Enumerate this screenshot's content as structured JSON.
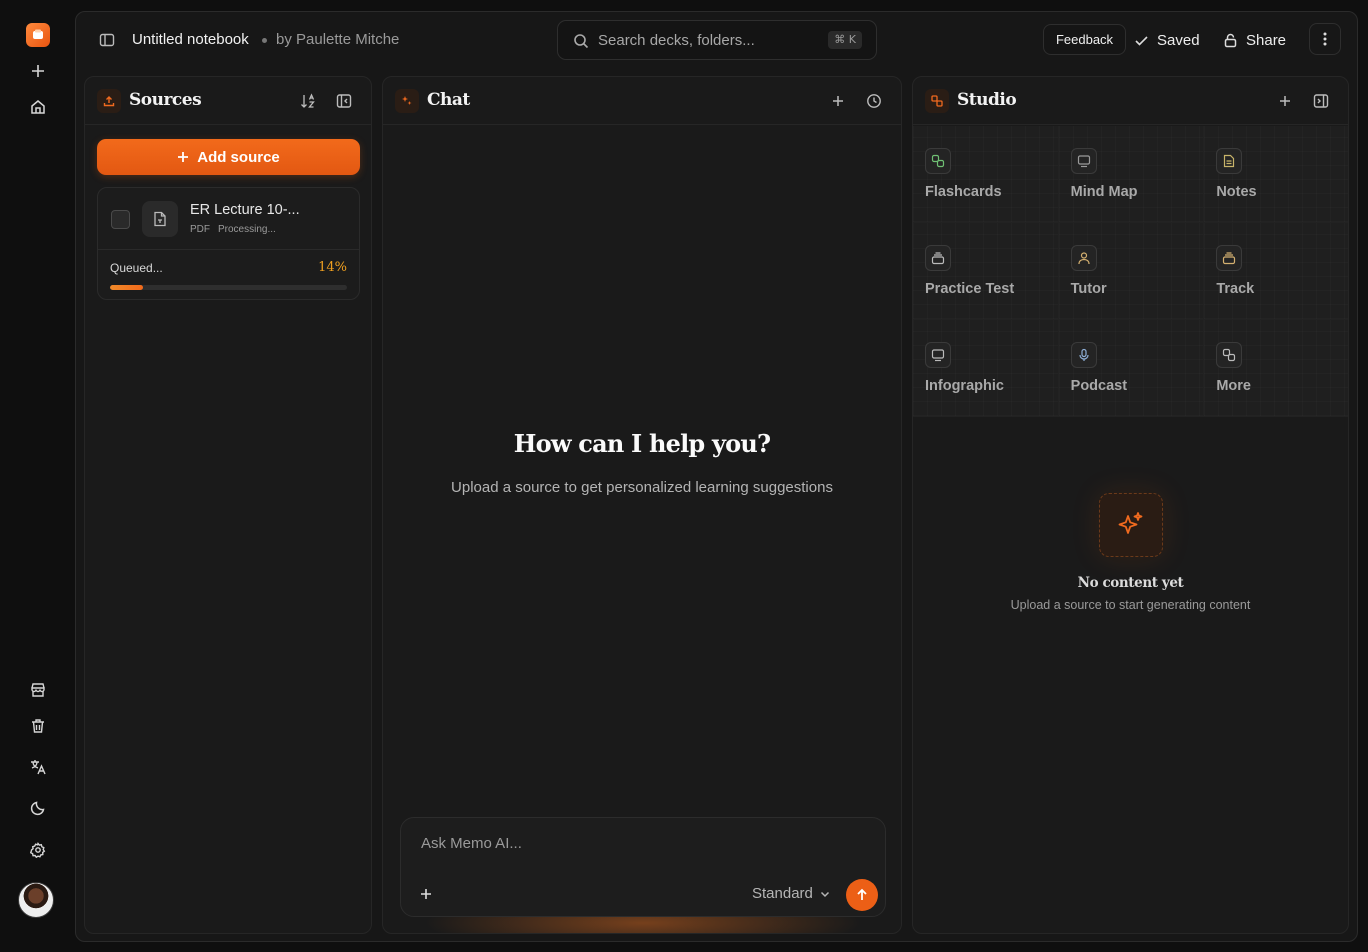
{
  "header": {
    "notebook_title": "Untitled notebook",
    "author": "by Paulette Mitche",
    "search_placeholder": "Search decks, folders...",
    "search_shortcut": "⌘ K",
    "feedback_label": "Feedback",
    "saved_label": "Saved",
    "share_label": "Share"
  },
  "sources": {
    "title": "Sources",
    "add_label": "Add source",
    "items": [
      {
        "name": "ER Lecture 10-...",
        "type": "PDF",
        "status": "Processing...",
        "queue_label": "Queued...",
        "progress_label": "14%",
        "progress": 0.14
      }
    ]
  },
  "chat": {
    "title": "Chat",
    "heading": "How can I help you?",
    "subheading": "Upload a source to get personalized learning suggestions",
    "input_placeholder": "Ask Memo AI...",
    "mode": "Standard"
  },
  "studio": {
    "title": "Studio",
    "tools": [
      {
        "label": "Flashcards",
        "icon": "flashcards-icon",
        "color": "#6fbf73"
      },
      {
        "label": "Mind Map",
        "icon": "mindmap-icon",
        "color": "#9a9a9a"
      },
      {
        "label": "Notes",
        "icon": "notes-icon",
        "color": "#c8b46a"
      },
      {
        "label": "Practice Test",
        "icon": "practice-test-icon",
        "color": "#bbbbbb"
      },
      {
        "label": "Tutor",
        "icon": "tutor-icon",
        "color": "#d4b070"
      },
      {
        "label": "Track",
        "icon": "track-icon",
        "color": "#d4b070"
      },
      {
        "label": "Infographic",
        "icon": "infographic-icon",
        "color": "#bbbbbb"
      },
      {
        "label": "Podcast",
        "icon": "podcast-icon",
        "color": "#8fb0d8"
      },
      {
        "label": "More",
        "icon": "more-icon",
        "color": "#bbbbbb"
      }
    ],
    "empty_title": "No content yet",
    "empty_subtitle": "Upload a source to start generating content"
  },
  "colors": {
    "accent": "#f26a1b",
    "background": "#0f0f0f",
    "panel": "#1a1a1a"
  }
}
